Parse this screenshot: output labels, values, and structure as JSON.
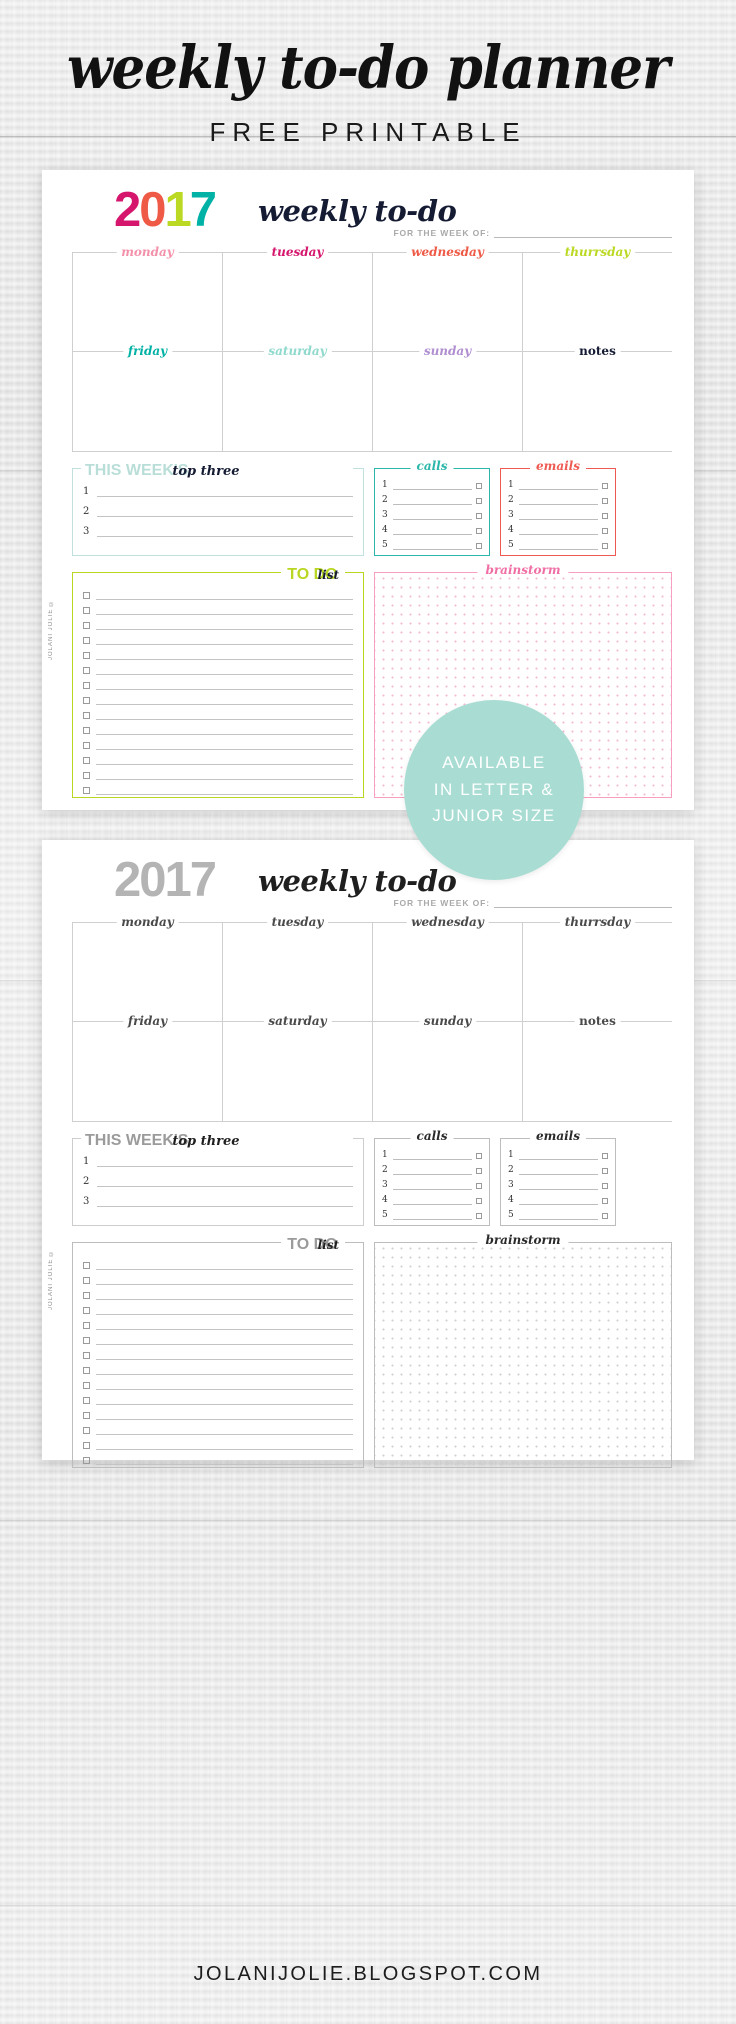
{
  "header": {
    "title": "weekly to-do planner",
    "subtitle": "FREE PRINTABLE"
  },
  "footer": {
    "url": "JOLANIJOLIE.BLOGSPOT.COM"
  },
  "badge": {
    "line1": "AVAILABLE",
    "line2": "IN LETTER &",
    "line3": "JUNIOR SIZE"
  },
  "planner": {
    "year": "2017",
    "year_digits": [
      {
        "char": "2",
        "color": "#d6156d"
      },
      {
        "char": "0",
        "color": "#ef5a47"
      },
      {
        "char": "1",
        "color": "#bbd923"
      },
      {
        "char": "7",
        "color": "#00b1a5"
      }
    ],
    "year_color_gray": "#b4b4b4",
    "script_title": "weekly to-do",
    "week_of_label": "FOR THE WEEK OF:",
    "credit": "JOLANI JOLIE ©",
    "days_row1": [
      {
        "label": "monday",
        "color": "#f491aa"
      },
      {
        "label": "tuesday",
        "color": "#d6156d"
      },
      {
        "label": "wednesday",
        "color": "#ef5a47"
      },
      {
        "label": "thurrsday",
        "color": "#bbd923"
      }
    ],
    "days_row2": [
      {
        "label": "friday",
        "color": "#00b1a5"
      },
      {
        "label": "saturday",
        "color": "#8fd9cd"
      },
      {
        "label": "sunday",
        "color": "#b08ed0"
      },
      {
        "label": "notes",
        "color": "#141b33",
        "plain": true
      }
    ],
    "top_three": {
      "heading_big": "THIS WEEK'S",
      "heading_big_color": "#b9ded8",
      "heading_script": "top three",
      "numbers": [
        "1",
        "2",
        "3"
      ]
    },
    "calls": {
      "title": "calls",
      "color": "#2ab7a9",
      "numbers": [
        "1",
        "2",
        "3",
        "4",
        "5"
      ]
    },
    "emails": {
      "title": "emails",
      "color": "#ee5a52",
      "numbers": [
        "1",
        "2",
        "3",
        "4",
        "5"
      ]
    },
    "todo": {
      "heading_big": "TO DO",
      "heading_big_color": "#b9d622",
      "heading_script": "list",
      "rows": 14
    },
    "brainstorm": {
      "title": "brainstorm",
      "color": "#f06ea4"
    }
  }
}
